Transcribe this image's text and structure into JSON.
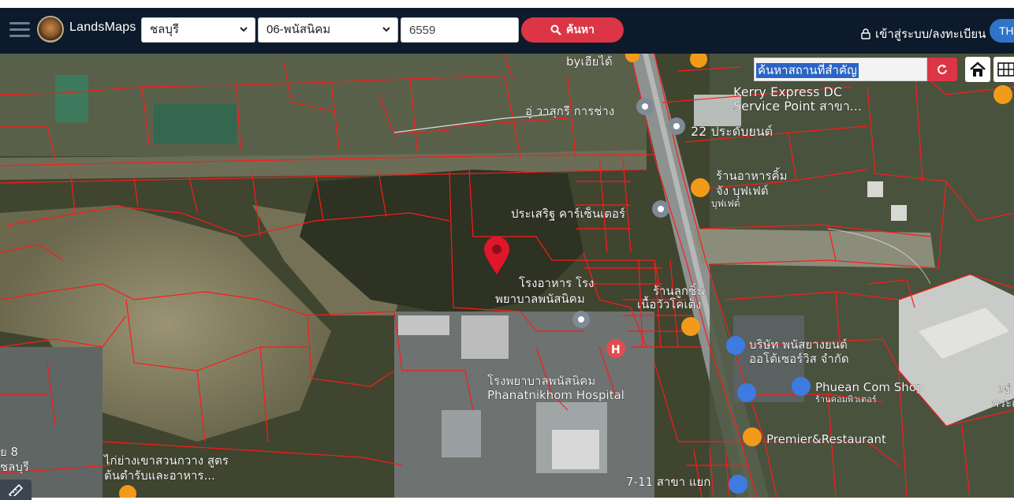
{
  "header": {
    "brand": "LandsMaps",
    "province_select": "ชลบุรี",
    "district_select": "06-พนัสนิคม",
    "parcel_input": "6559",
    "search_button": "ค้นหา",
    "login_link": "เข้าสู่ระบบ/ลงทะเบียน",
    "language": "TH"
  },
  "map": {
    "place_search_value": "ค้นหาสถานที่สำคัญ",
    "labels": {
      "byhiedi": "byเฮียได้",
      "kerry1": "Kerry Express DC",
      "kerry2": "Service Point สาขา...",
      "wasukri": "อู่ วาสุกรี การช่าง",
      "prabyon": "22 ประดับยนต์",
      "restaurant1": "ร้านอาหารคิ้ม",
      "restaurant2": "จัง บุฟเฟต์",
      "restaurant3": "บุฟเฟต์",
      "prasert": "ประเสริฐ คาร์เซ็นเตอร์",
      "canteen1": "โรงอาหาร โรง",
      "canteen2": "พยาบาลพนัสนิคม",
      "shop1": "ร้านลูกชิ้น",
      "shop2": "เนื้อวัวโคเต็ง",
      "company1": "บริษัท พนัสยางยนต์",
      "company2": "ออโต้เซอร์วิส จำกัด",
      "hospital_th": "โรงพยาบาลพนัสนิคม",
      "hospital_en": "Phanatnikhom Hospital",
      "phuean1": "Phuean Com Shop",
      "phuean2": "ร้านคอมพิวเตอร์",
      "premier": "Premier&Restaurant",
      "chicken1": "ไก่ย่างเขาสวนกวาง สูตร",
      "chicken2": "ต้นตำรับและอาหาร...",
      "seven": "7-11 สาขา แยก",
      "right_edge1": "เช่",
      "right_edge2": "กระเ",
      "left_edge1": "ย 8",
      "left_edge2": "ชลบุรี"
    }
  },
  "colors": {
    "navbar": "#0d1a2b",
    "accent_red": "#dc3545",
    "parcel_line": "#ff1a1a",
    "lang_badge": "#2f74c9"
  },
  "icons": {
    "menu": "hamburger-icon",
    "search": "magnifier-icon",
    "lock": "lock-icon",
    "refresh": "refresh-icon",
    "home": "home-icon",
    "grid": "grid-icon",
    "pin": "location-pin-icon",
    "ruler": "ruler-icon"
  }
}
